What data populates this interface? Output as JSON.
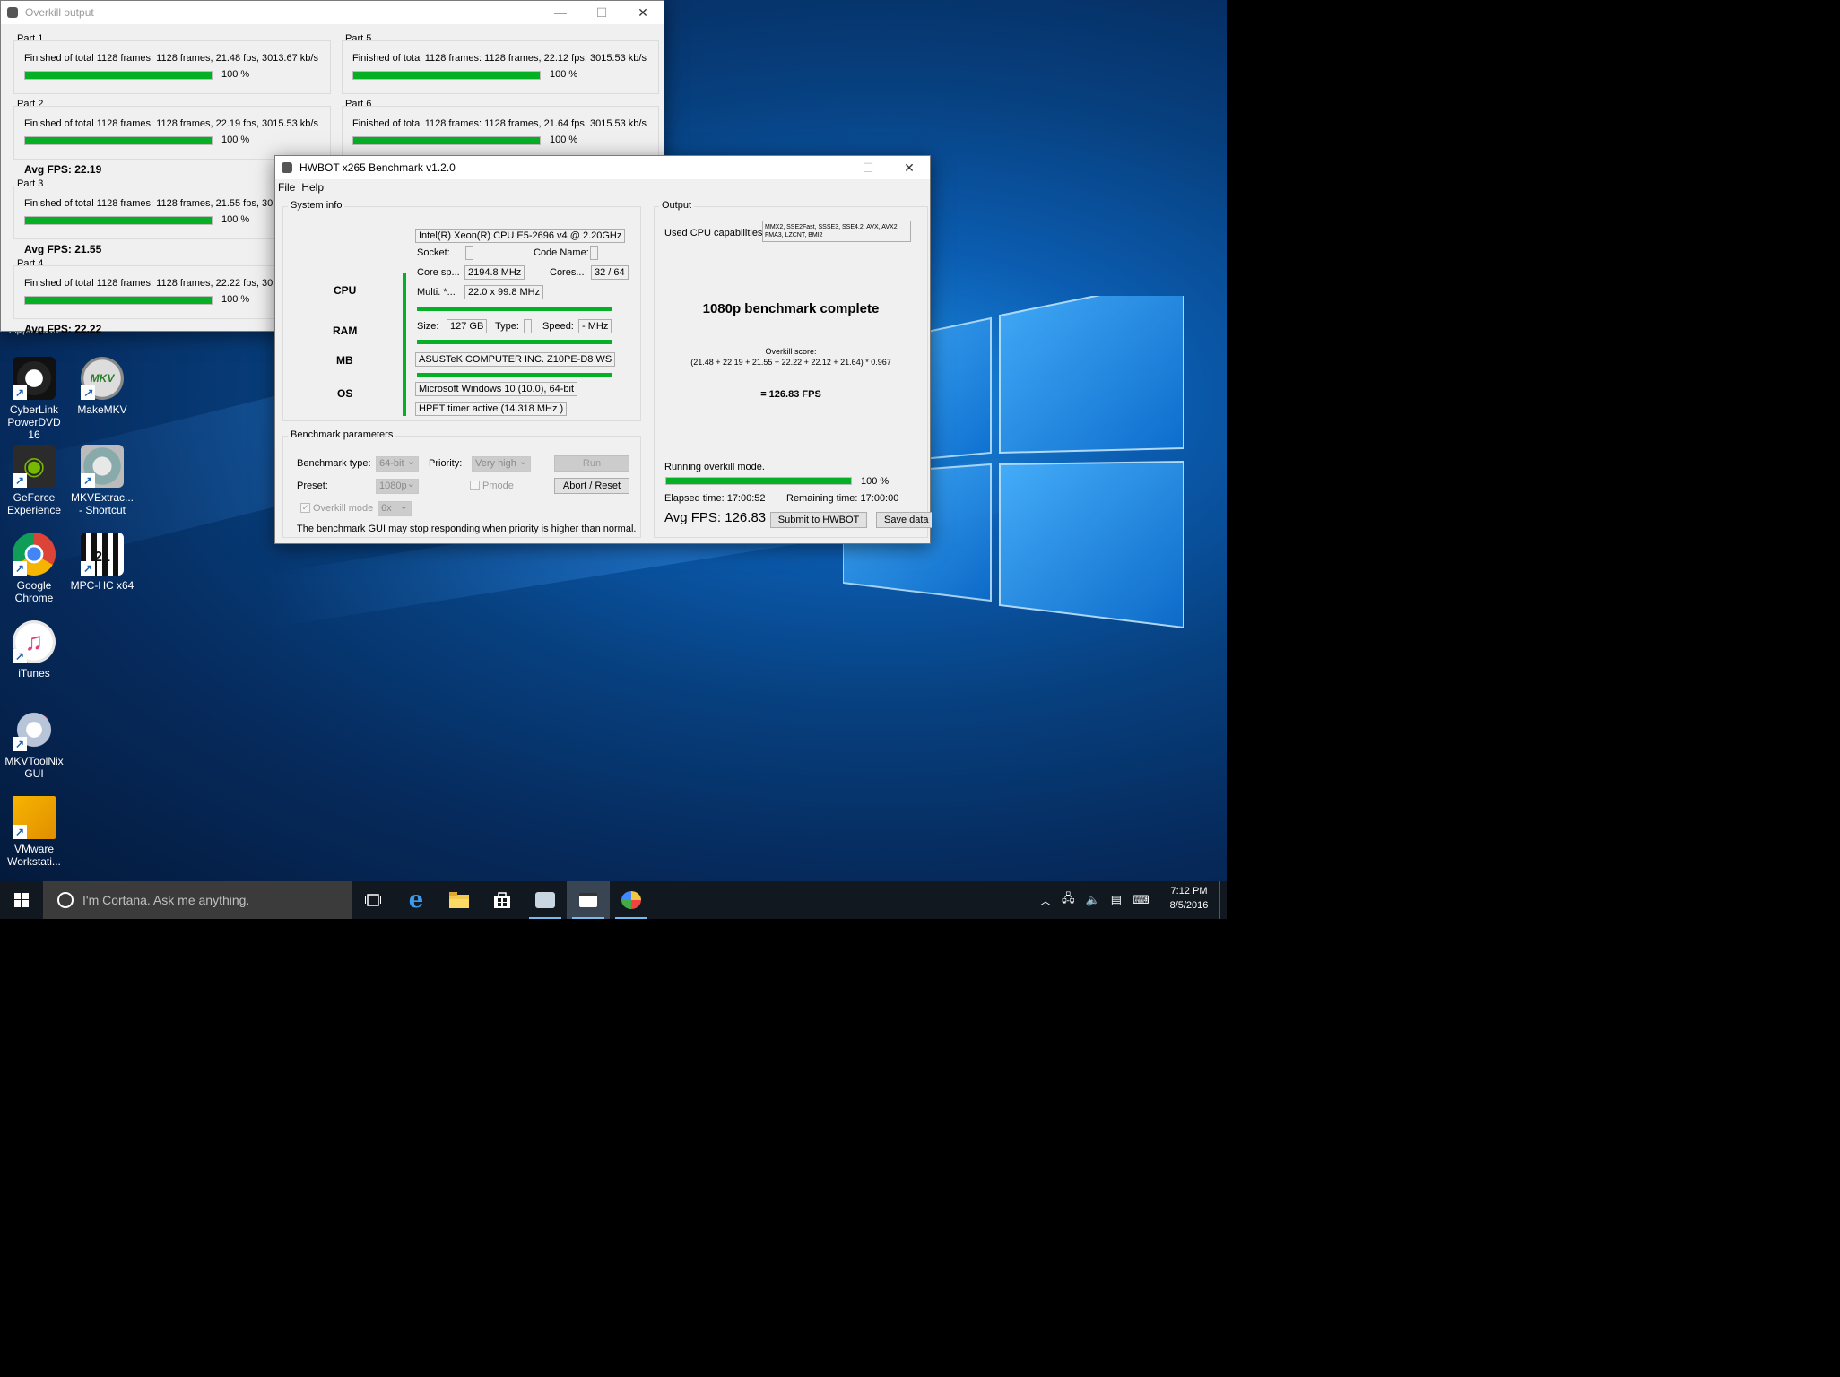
{
  "desktop": {
    "icons": [
      {
        "label_1": "Applicati...",
        "label_2": ""
      },
      {
        "label_1": "CyberLink",
        "label_2": "PowerDVD 16"
      },
      {
        "label_1": "MakeMKV",
        "label_2": ""
      },
      {
        "label_1": "GeForce",
        "label_2": "Experience"
      },
      {
        "label_1": "MKVExtrac...",
        "label_2": "- Shortcut"
      },
      {
        "label_1": "Google",
        "label_2": "Chrome"
      },
      {
        "label_1": "MPC-HC x64",
        "label_2": ""
      },
      {
        "label_1": "iTunes",
        "label_2": ""
      },
      {
        "label_1": "MKVToolNix",
        "label_2": "GUI"
      },
      {
        "label_1": "VMware",
        "label_2": "Workstati..."
      }
    ]
  },
  "overkill": {
    "title": "Overkill output",
    "parts": [
      {
        "label": "Part 1",
        "text": "Finished of total 1128 frames: 1128 frames, 21.48 fps,  3013.67 kb/s",
        "percent": "100 %",
        "progress": 1.0,
        "avg": ""
      },
      {
        "label": "Part 5",
        "text": "Finished of total 1128 frames: 1128 frames, 22.12 fps,  3015.53 kb/s",
        "percent": "100 %",
        "progress": 1.0,
        "avg": ""
      },
      {
        "label": "Part 2",
        "text": "Finished of total 1128 frames: 1128 frames, 22.19 fps,  3015.53 kb/s",
        "percent": "100 %",
        "progress": 1.0,
        "avg": "Avg FPS: 22.19"
      },
      {
        "label": "Part 6",
        "text": "Finished of total 1128 frames: 1128 frames, 21.64 fps,  3015.53 kb/s",
        "percent": "100 %",
        "progress": 1.0,
        "avg": ""
      },
      {
        "label": "Part 3",
        "text": "Finished of total 1128 frames: 1128 frames, 21.55 fps,  30",
        "percent": "100 %",
        "progress": 1.0,
        "avg": "Avg FPS: 21.55"
      },
      {
        "label": "Part 4",
        "text": "Finished of total 1128 frames: 1128 frames, 22.22 fps,  30",
        "percent": "100 %",
        "progress": 1.0,
        "avg": "Avg FPS: 22.22"
      }
    ]
  },
  "bench": {
    "title": "HWBOT x265 Benchmark v1.2.0",
    "menu": {
      "file": "File",
      "help": "Help"
    },
    "sysinfo": {
      "group": "System info",
      "cpu_name": "Intel(R) Xeon(R) CPU E5-2696 v4 @ 2.20GHz",
      "socket_label": "Socket:",
      "codename_label": "Code Name:",
      "corespeed_label": "Core sp...",
      "corespeed": "2194.8 MHz",
      "cores_label": "Cores...",
      "cores": "32 / 64",
      "multi_label": "Multi. *...",
      "multi": "22.0 x 99.8 MHz",
      "size_label": "Size:",
      "size": "127 GB",
      "type_label": "Type:",
      "speed_label": "Speed:",
      "speed": "- MHz",
      "mb": "ASUSTeK COMPUTER INC. Z10PE-D8 WS",
      "os": "Microsoft Windows 10 (10.0), 64-bit",
      "timer": "HPET timer active (14.318 MHz )",
      "hdr_cpu": "CPU",
      "hdr_ram": "RAM",
      "hdr_mb": "MB",
      "hdr_os": "OS"
    },
    "params": {
      "group": "Benchmark parameters",
      "type_label": "Benchmark type:",
      "type": "64-bit",
      "priority_label": "Priority:",
      "priority": "Very high",
      "run": "Run",
      "preset_label": "Preset:",
      "preset": "1080p",
      "pmode": "Pmode",
      "abort": "Abort / Reset",
      "overkill_label": "Overkill mode",
      "overkill": "6x",
      "warning": "The benchmark GUI may stop responding when priority is higher than normal."
    },
    "output": {
      "group": "Output",
      "caps_label": "Used CPU capabilities:",
      "caps": "MMX2, SSE2Fast, SSSE3, SSE4.2, AVX, AVX2, FMA3, LZCNT, BMI2",
      "complete": "1080p benchmark complete",
      "score_label": "Overkill score:",
      "formula": "(21.48 + 22.19 + 21.55 + 22.22 + 22.12 + 21.64) * 0.967",
      "result": "= 126.83 FPS",
      "status": "Running overkill mode.",
      "percent": "100 %",
      "progress": 1.0,
      "elapsed": "Elapsed time: 17:00:52",
      "remaining": "Remaining time: 17:00:00",
      "avg": "Avg FPS: 126.83",
      "submit": "Submit to HWBOT",
      "save": "Save data t"
    }
  },
  "taskbar": {
    "search_placeholder": "I'm Cortana. Ask me anything.",
    "time": "7:12 PM",
    "date": "8/5/2016"
  }
}
